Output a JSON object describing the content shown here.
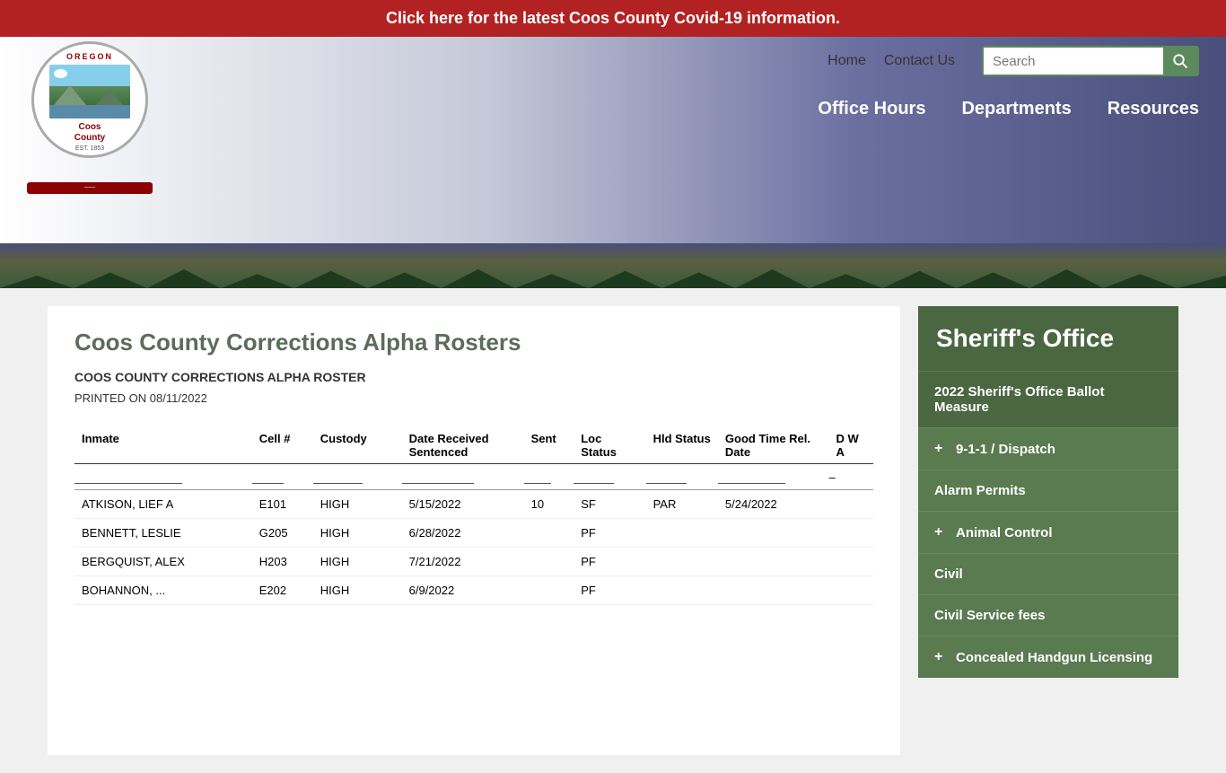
{
  "covid_banner": {
    "text": "Click here for the latest Coos County Covid-19 information."
  },
  "header": {
    "logo": {
      "oregon_text": "OREGON",
      "coos_county_text": "Coos\nCounty",
      "est_text": "EST. 1853"
    },
    "nav": {
      "home_label": "Home",
      "contact_label": "Contact Us"
    },
    "search": {
      "placeholder": "Search",
      "button_label": "🔍"
    },
    "bottom_nav": {
      "office_hours_label": "Office Hours",
      "departments_label": "Departments",
      "resources_label": "Resources"
    }
  },
  "page": {
    "title": "Coos County Corrections Alpha Rosters",
    "roster_title": "COOS COUNTY CORRECTIONS ALPHA ROSTER",
    "printed_on": "PRINTED ON 08/11/2022"
  },
  "table": {
    "headers": [
      "Inmate",
      "Cell #",
      "Custody",
      "Date Received Sentenced",
      "Sent",
      "Loc Status",
      "Hld Status",
      "Good Time Rel. Date",
      "D W A"
    ],
    "rows": [
      {
        "inmate": "ATKISON, LIEF A",
        "cell": "E101",
        "custody": "HIGH",
        "date": "5/15/2022",
        "sent": "10",
        "loc_status": "SF",
        "hld_status": "PAR",
        "good_time": "5/24/2022",
        "dwa": ""
      },
      {
        "inmate": "BENNETT, LESLIE",
        "cell": "G205",
        "custody": "HIGH",
        "date": "6/28/2022",
        "sent": "",
        "loc_status": "PF",
        "hld_status": "",
        "good_time": "",
        "dwa": ""
      },
      {
        "inmate": "BERGQUIST, ALEX",
        "cell": "H203",
        "custody": "HIGH",
        "date": "7/21/2022",
        "sent": "",
        "loc_status": "PF",
        "hld_status": "",
        "good_time": "",
        "dwa": ""
      },
      {
        "inmate": "BOHANNON, ...",
        "cell": "E202",
        "custody": "HIGH",
        "date": "6/9/2022",
        "sent": "",
        "loc_status": "PF",
        "hld_status": "",
        "good_time": "",
        "dwa": ""
      }
    ]
  },
  "sidebar": {
    "title": "Sheriff's Office",
    "items": [
      {
        "label": "2022 Sheriff's Office Ballot Measure",
        "has_plus": false,
        "active": true
      },
      {
        "label": "9-1-1 / Dispatch",
        "has_plus": true,
        "active": false
      },
      {
        "label": "Alarm Permits",
        "has_plus": false,
        "active": false
      },
      {
        "label": "Animal Control",
        "has_plus": true,
        "active": false
      },
      {
        "label": "Civil",
        "has_plus": false,
        "active": false
      },
      {
        "label": "Civil Service fees",
        "has_plus": false,
        "active": false
      },
      {
        "label": "Concealed Handgun Licensing",
        "has_plus": true,
        "active": false
      }
    ]
  }
}
